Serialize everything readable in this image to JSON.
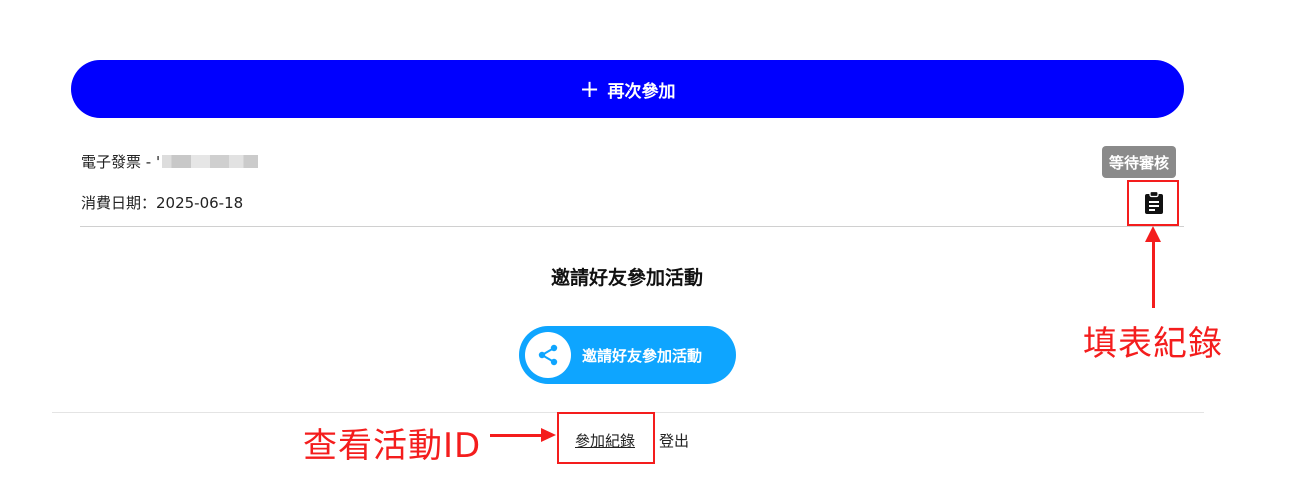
{
  "rejoin_button": {
    "icon": "plus-icon",
    "label": "再次參加"
  },
  "record": {
    "title": "電子發票 - '",
    "date_text": "消費日期：2025-06-18",
    "status": "等待審核",
    "form_icon": "clipboard-icon"
  },
  "invite": {
    "heading": "邀請好友參加活動",
    "button_label": "邀請好友參加活動",
    "icon": "share-icon"
  },
  "footer": {
    "records_link": "參加紀錄",
    "logout_link": "登出"
  },
  "annotations": {
    "form_record": "填表紀錄",
    "view_activity_id": "查看活動ID"
  },
  "colors": {
    "primary": "#0000ff",
    "invite": "#0ea5ff",
    "badge": "#8a8a8a",
    "annotation": "#f41d1d"
  }
}
